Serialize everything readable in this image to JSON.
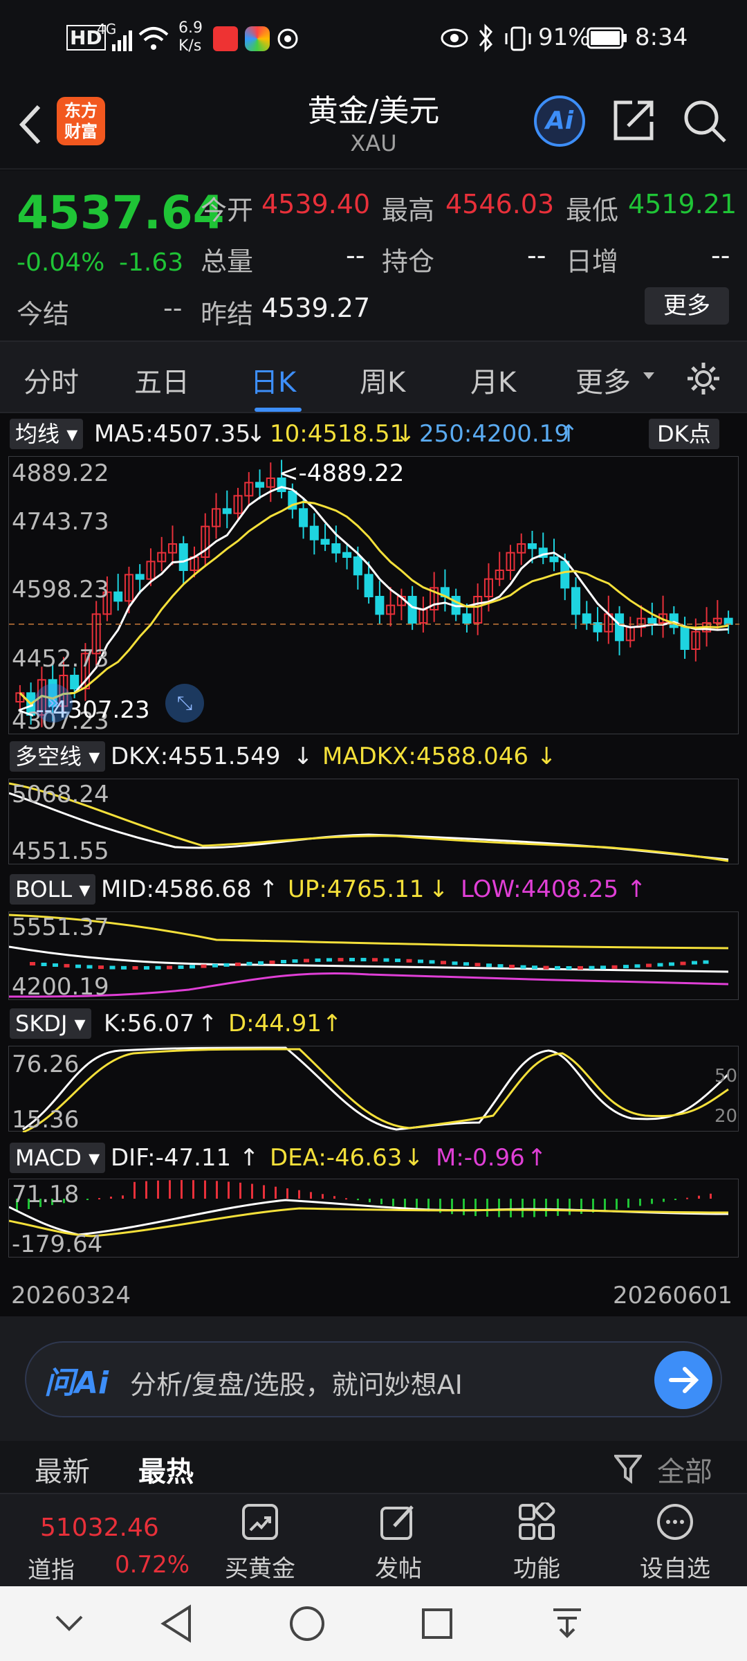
{
  "status_bar": {
    "hd": "HD",
    "net": "4G",
    "speed_value": "6.9",
    "speed_unit": "K/s",
    "battery": "91%",
    "time": "8:34"
  },
  "header": {
    "logo_line1": "东方",
    "logo_line2": "财富",
    "title": "黄金/美元",
    "subtitle": "XAU",
    "ai_label": "Ai"
  },
  "quote": {
    "price": "4537.64",
    "change_pct": "-0.04%",
    "change": "-1.63",
    "open_label": "今开",
    "open": "4539.40",
    "high_label": "最高",
    "high": "4546.03",
    "low_label": "最低",
    "low": "4519.21",
    "volume_label": "总量",
    "volume": "--",
    "position_label": "持仓",
    "position": "--",
    "daily_inc_label": "日增",
    "daily_inc": "--",
    "settle_label": "今结",
    "settle": "--",
    "prev_settle_label": "昨结",
    "prev_settle": "4539.27",
    "more": "更多"
  },
  "tabs": {
    "items": [
      "分时",
      "五日",
      "日K",
      "周K",
      "月K",
      "更多"
    ],
    "active": "日K"
  },
  "indicators": {
    "ma": {
      "name": "均线",
      "ma5": "MA5:4507.35",
      "ma10": "10:4518.51",
      "ma250": "250:4200.19",
      "dk": "DK点"
    },
    "dkx": {
      "name": "多空线",
      "dkx": "DKX:4551.549",
      "madkx": "MADKX:4588.046",
      "ytop": "5068.24",
      "ybot": "4551.55"
    },
    "boll": {
      "name": "BOLL",
      "mid": "MID:4586.68",
      "up": "UP:4765.11",
      "low": "LOW:4408.25",
      "ytop": "5551.37",
      "ybot": "4200.19"
    },
    "skdj": {
      "name": "SKDJ",
      "k": "K:56.07",
      "d": "D:44.91",
      "ytop": "76.26",
      "ybot": "15.36",
      "r50": "50",
      "r20": "20"
    },
    "macd": {
      "name": "MACD",
      "dif": "DIF:-47.11",
      "dea": "DEA:-46.63",
      "m": "M:-0.96",
      "ytop": "71.18",
      "ybot": "-179.64"
    }
  },
  "kline": {
    "y_labels": [
      "4889.22",
      "4743.73",
      "4598.23",
      "4452.73",
      "4307.23"
    ],
    "max_marker": "<-4889.22",
    "min_marker": "<--4307.23"
  },
  "dates": {
    "start": "20260324",
    "end": "20260601"
  },
  "ai_bar": {
    "brand": "问Ai",
    "placeholder": "分析/复盘/选股，就问妙想AI"
  },
  "news_tabs": {
    "latest": "最新",
    "hot": "最热",
    "filter": "全部"
  },
  "toolbar": {
    "index_value": "51032.46",
    "index_name": "道指",
    "index_change": "0.72%",
    "buy_gold": "买黄金",
    "post": "发帖",
    "functions": "功能",
    "watchlist": "设自选"
  },
  "colors": {
    "up": "#e8303a",
    "down": "#1fc436",
    "accent": "#3d8ef8",
    "yellow": "#f4e03a",
    "magenta": "#e03fd6",
    "cyan": "#1ed4e0"
  }
}
